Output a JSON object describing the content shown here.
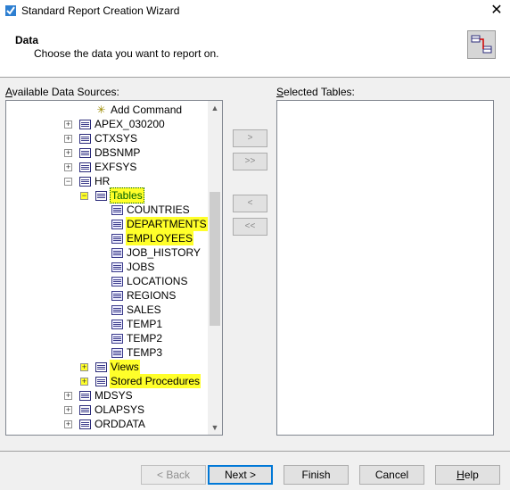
{
  "window": {
    "title": "Standard Report Creation Wizard",
    "close_label": "✕"
  },
  "header": {
    "title": "Data",
    "subtitle": "Choose the data you want to report on."
  },
  "available": {
    "label": "Available Data Sources:",
    "tree": [
      {
        "label": "Add Command",
        "icon": "star-icon"
      },
      {
        "label": "APEX_030200",
        "expander": "+",
        "icon": "table-icon"
      },
      {
        "label": "CTXSYS",
        "expander": "+",
        "icon": "table-icon"
      },
      {
        "label": "DBSNMP",
        "expander": "+",
        "icon": "table-icon"
      },
      {
        "label": "EXFSYS",
        "expander": "+",
        "icon": "table-icon"
      },
      {
        "label": "HR",
        "expander": "-",
        "icon": "table-icon"
      },
      {
        "label": "Tables",
        "expander": "-",
        "icon": "table-icon",
        "highlighted": true,
        "selected": true
      },
      {
        "label": "COUNTRIES",
        "icon": "table-icon"
      },
      {
        "label": "DEPARTMENTS",
        "icon": "table-icon",
        "highlighted": true
      },
      {
        "label": "EMPLOYEES",
        "icon": "table-icon",
        "highlighted": true
      },
      {
        "label": "JOB_HISTORY",
        "icon": "table-icon"
      },
      {
        "label": "JOBS",
        "icon": "table-icon"
      },
      {
        "label": "LOCATIONS",
        "icon": "table-icon"
      },
      {
        "label": "REGIONS",
        "icon": "table-icon"
      },
      {
        "label": "SALES",
        "icon": "table-icon"
      },
      {
        "label": "TEMP1",
        "icon": "table-icon"
      },
      {
        "label": "TEMP2",
        "icon": "table-icon"
      },
      {
        "label": "TEMP3",
        "icon": "table-icon"
      },
      {
        "label": "Views",
        "expander": "+",
        "icon": "table-icon",
        "highlighted": true
      },
      {
        "label": "Stored Procedures",
        "expander": "+",
        "icon": "table-icon",
        "highlighted": true
      },
      {
        "label": "MDSYS",
        "expander": "+",
        "icon": "table-icon"
      },
      {
        "label": "OLAPSYS",
        "expander": "+",
        "icon": "table-icon"
      },
      {
        "label": "ORDDATA",
        "expander": "+",
        "icon": "table-icon"
      }
    ]
  },
  "selected": {
    "label": "Selected Tables:"
  },
  "move_buttons": {
    "add": ">",
    "add_all": ">>",
    "remove": "<",
    "remove_all": "<<"
  },
  "footer": {
    "back": "< Back",
    "next": "Next >",
    "finish": "Finish",
    "cancel": "Cancel",
    "help": "Help"
  },
  "colors": {
    "highlight": "#ffff2a",
    "accent": "#0078d7"
  }
}
